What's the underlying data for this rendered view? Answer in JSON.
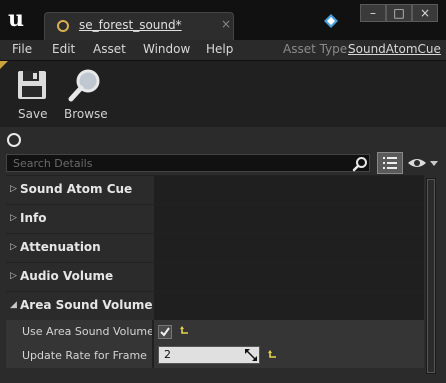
{
  "titlebar": {
    "tab_title": "se_forest_sound*",
    "tab_close": "×",
    "minimize": "–",
    "maximize": "□",
    "close": "×"
  },
  "menu": {
    "items": [
      "File",
      "Edit",
      "Asset",
      "Window",
      "Help"
    ],
    "asset_type_label": "Asset Type:",
    "asset_type_value": "SoundAtomCue"
  },
  "toolbar": {
    "save_label": "Save",
    "browse_label": "Browse"
  },
  "details": {
    "search_placeholder": "Search Details",
    "categories": [
      {
        "label": "Sound Atom Cue",
        "arrow": "▷"
      },
      {
        "label": "Info",
        "arrow": "▷"
      },
      {
        "label": "Attenuation",
        "arrow": "▷"
      },
      {
        "label": "Audio Volume",
        "arrow": "▷"
      },
      {
        "label": "Area Sound Volume",
        "arrow": "◢"
      }
    ],
    "properties": {
      "use_area_sound_volume": {
        "label": "Use Area Sound Volume",
        "checked": true
      },
      "update_rate": {
        "label": "Update Rate for Frame",
        "value": "2"
      }
    }
  },
  "colors": {
    "accent": "#c9a33d",
    "reset_arrow": "#e6d44a"
  }
}
